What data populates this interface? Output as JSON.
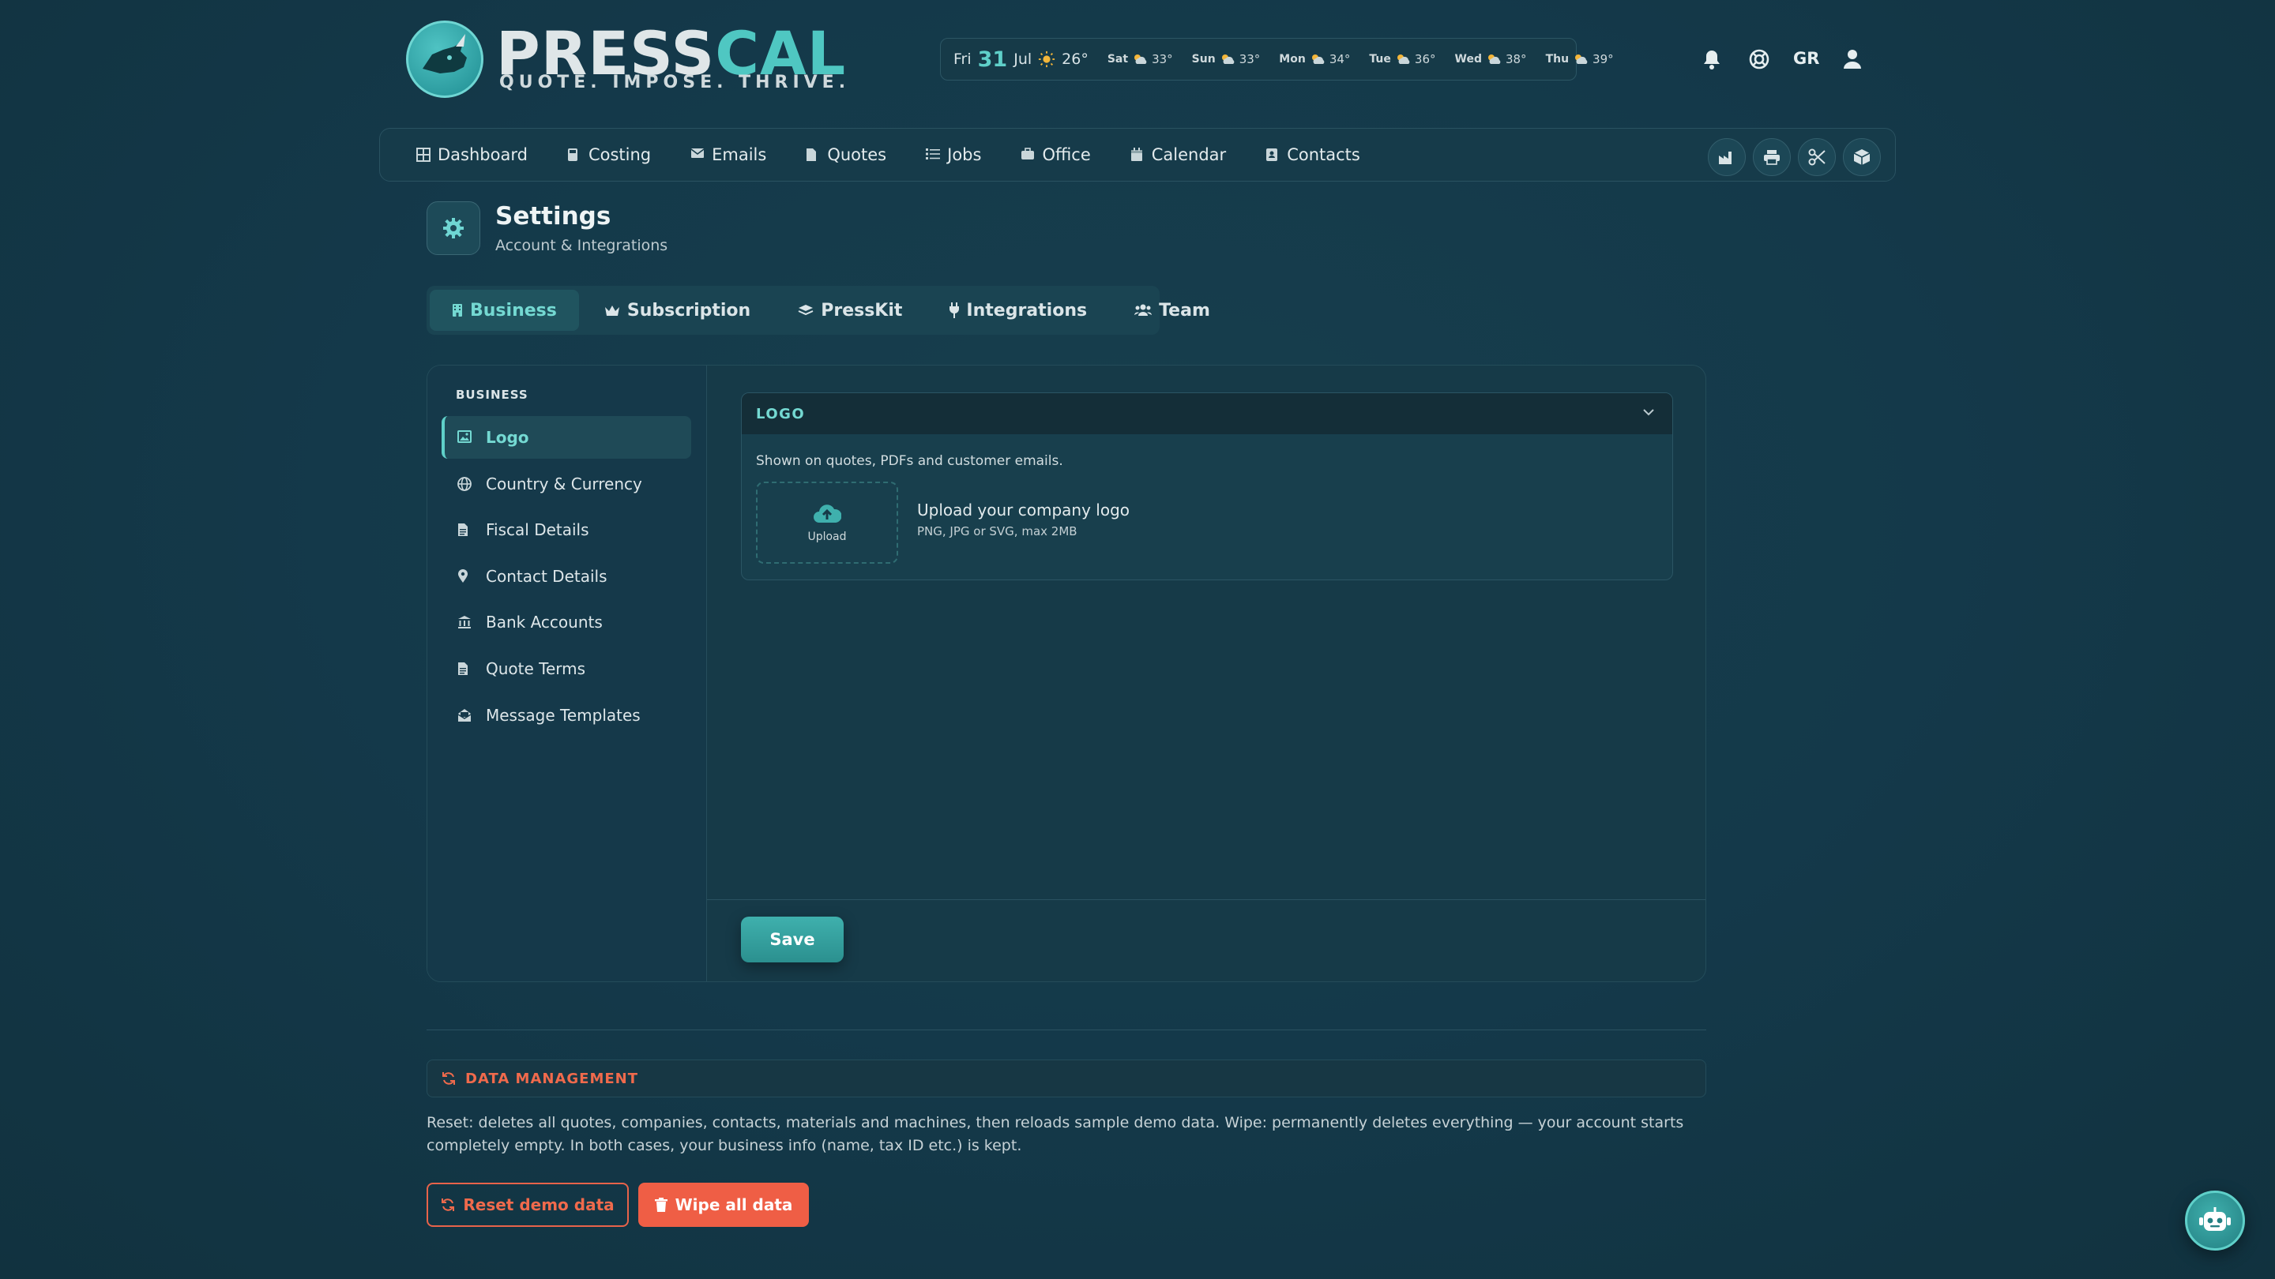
{
  "brand": {
    "name_part1": "PRESS",
    "name_part2": "CAL",
    "tagline": "QUOTE. IMPOSE. THRIVE.",
    "logo_icon": "rhino-icon"
  },
  "weather": {
    "today": {
      "day": "Fri",
      "date": "31",
      "month": "Jul",
      "temp": "26°",
      "icon": "sun-icon"
    },
    "forecast": [
      {
        "day": "Sat",
        "temp": "33°",
        "icon": "cloud-sun-icon"
      },
      {
        "day": "Sun",
        "temp": "33°",
        "icon": "cloud-sun-icon"
      },
      {
        "day": "Mon",
        "temp": "34°",
        "icon": "cloud-sun-icon"
      },
      {
        "day": "Tue",
        "temp": "36°",
        "icon": "cloud-sun-icon"
      },
      {
        "day": "Wed",
        "temp": "38°",
        "icon": "cloud-sun-icon"
      },
      {
        "day": "Thu",
        "temp": "39°",
        "icon": "cloud-sun-icon"
      }
    ]
  },
  "header": {
    "language": "GR",
    "icons": [
      "bell-icon",
      "help-icon",
      "user-icon"
    ]
  },
  "nav": {
    "items": [
      {
        "label": "Dashboard",
        "icon": "dashboard-icon"
      },
      {
        "label": "Costing",
        "icon": "calculator-icon"
      },
      {
        "label": "Emails",
        "icon": "envelope-icon"
      },
      {
        "label": "Quotes",
        "icon": "file-icon"
      },
      {
        "label": "Jobs",
        "icon": "list-icon"
      },
      {
        "label": "Office",
        "icon": "briefcase-icon"
      },
      {
        "label": "Calendar",
        "icon": "calendar-icon"
      },
      {
        "label": "Contacts",
        "icon": "address-book-icon"
      }
    ],
    "tools": [
      "factory-icon",
      "printer-icon",
      "scissors-icon",
      "box-icon"
    ]
  },
  "page": {
    "title": "Settings",
    "subtitle": "Account & Integrations",
    "icon": "gear-icon"
  },
  "tabs": [
    {
      "label": "Business",
      "icon": "building-icon",
      "active": true
    },
    {
      "label": "Subscription",
      "icon": "crown-icon",
      "active": false
    },
    {
      "label": "PressKit",
      "icon": "layers-icon",
      "active": false
    },
    {
      "label": "Integrations",
      "icon": "plug-icon",
      "active": false
    },
    {
      "label": "Team",
      "icon": "users-icon",
      "active": false
    }
  ],
  "sidebar": {
    "heading": "BUSINESS",
    "items": [
      {
        "label": "Logo",
        "icon": "image-icon",
        "active": true
      },
      {
        "label": "Country & Currency",
        "icon": "globe-icon",
        "active": false
      },
      {
        "label": "Fiscal Details",
        "icon": "document-icon",
        "active": false
      },
      {
        "label": "Contact Details",
        "icon": "map-pin-icon",
        "active": false
      },
      {
        "label": "Bank Accounts",
        "icon": "bank-icon",
        "active": false
      },
      {
        "label": "Quote Terms",
        "icon": "document-icon",
        "active": false
      },
      {
        "label": "Message Templates",
        "icon": "envelope-open-icon",
        "active": false
      }
    ]
  },
  "logo_section": {
    "heading": "LOGO",
    "description": "Shown on quotes, PDFs and customer emails.",
    "upload_label": "Upload",
    "upload_title": "Upload your company logo",
    "upload_hint": "PNG, JPG or SVG, max 2MB"
  },
  "actions": {
    "save_label": "Save"
  },
  "data_management": {
    "heading": "DATA MANAGEMENT",
    "description": "Reset: deletes all quotes, companies, contacts, materials and machines, then reloads sample demo data. Wipe: permanently deletes everything — your account starts completely empty. In both cases, your business info (name, tax ID etc.) is kept.",
    "reset_label": "Reset demo data",
    "wipe_label": "Wipe all data"
  },
  "colors": {
    "accent": "#5fd0c9",
    "danger": "#ef5e45",
    "background": "#14394a"
  }
}
